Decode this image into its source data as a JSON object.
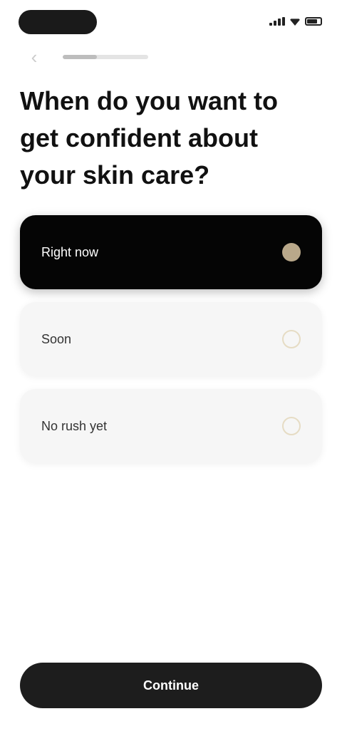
{
  "header": {
    "back_icon": "chevron-left-icon",
    "progress_fraction": 0.4
  },
  "question": {
    "text": "When do you want to get confident about your skin care?"
  },
  "options": [
    {
      "label": "Right now",
      "selected": true
    },
    {
      "label": "Soon",
      "selected": false
    },
    {
      "label": "No rush yet",
      "selected": false
    }
  ],
  "continue": {
    "label": "Continue"
  },
  "colors": {
    "selected_bg": "#050505",
    "accent": "#b9a88a",
    "unselected_bg": "#f6f6f6",
    "button_bg": "#1d1d1d"
  }
}
